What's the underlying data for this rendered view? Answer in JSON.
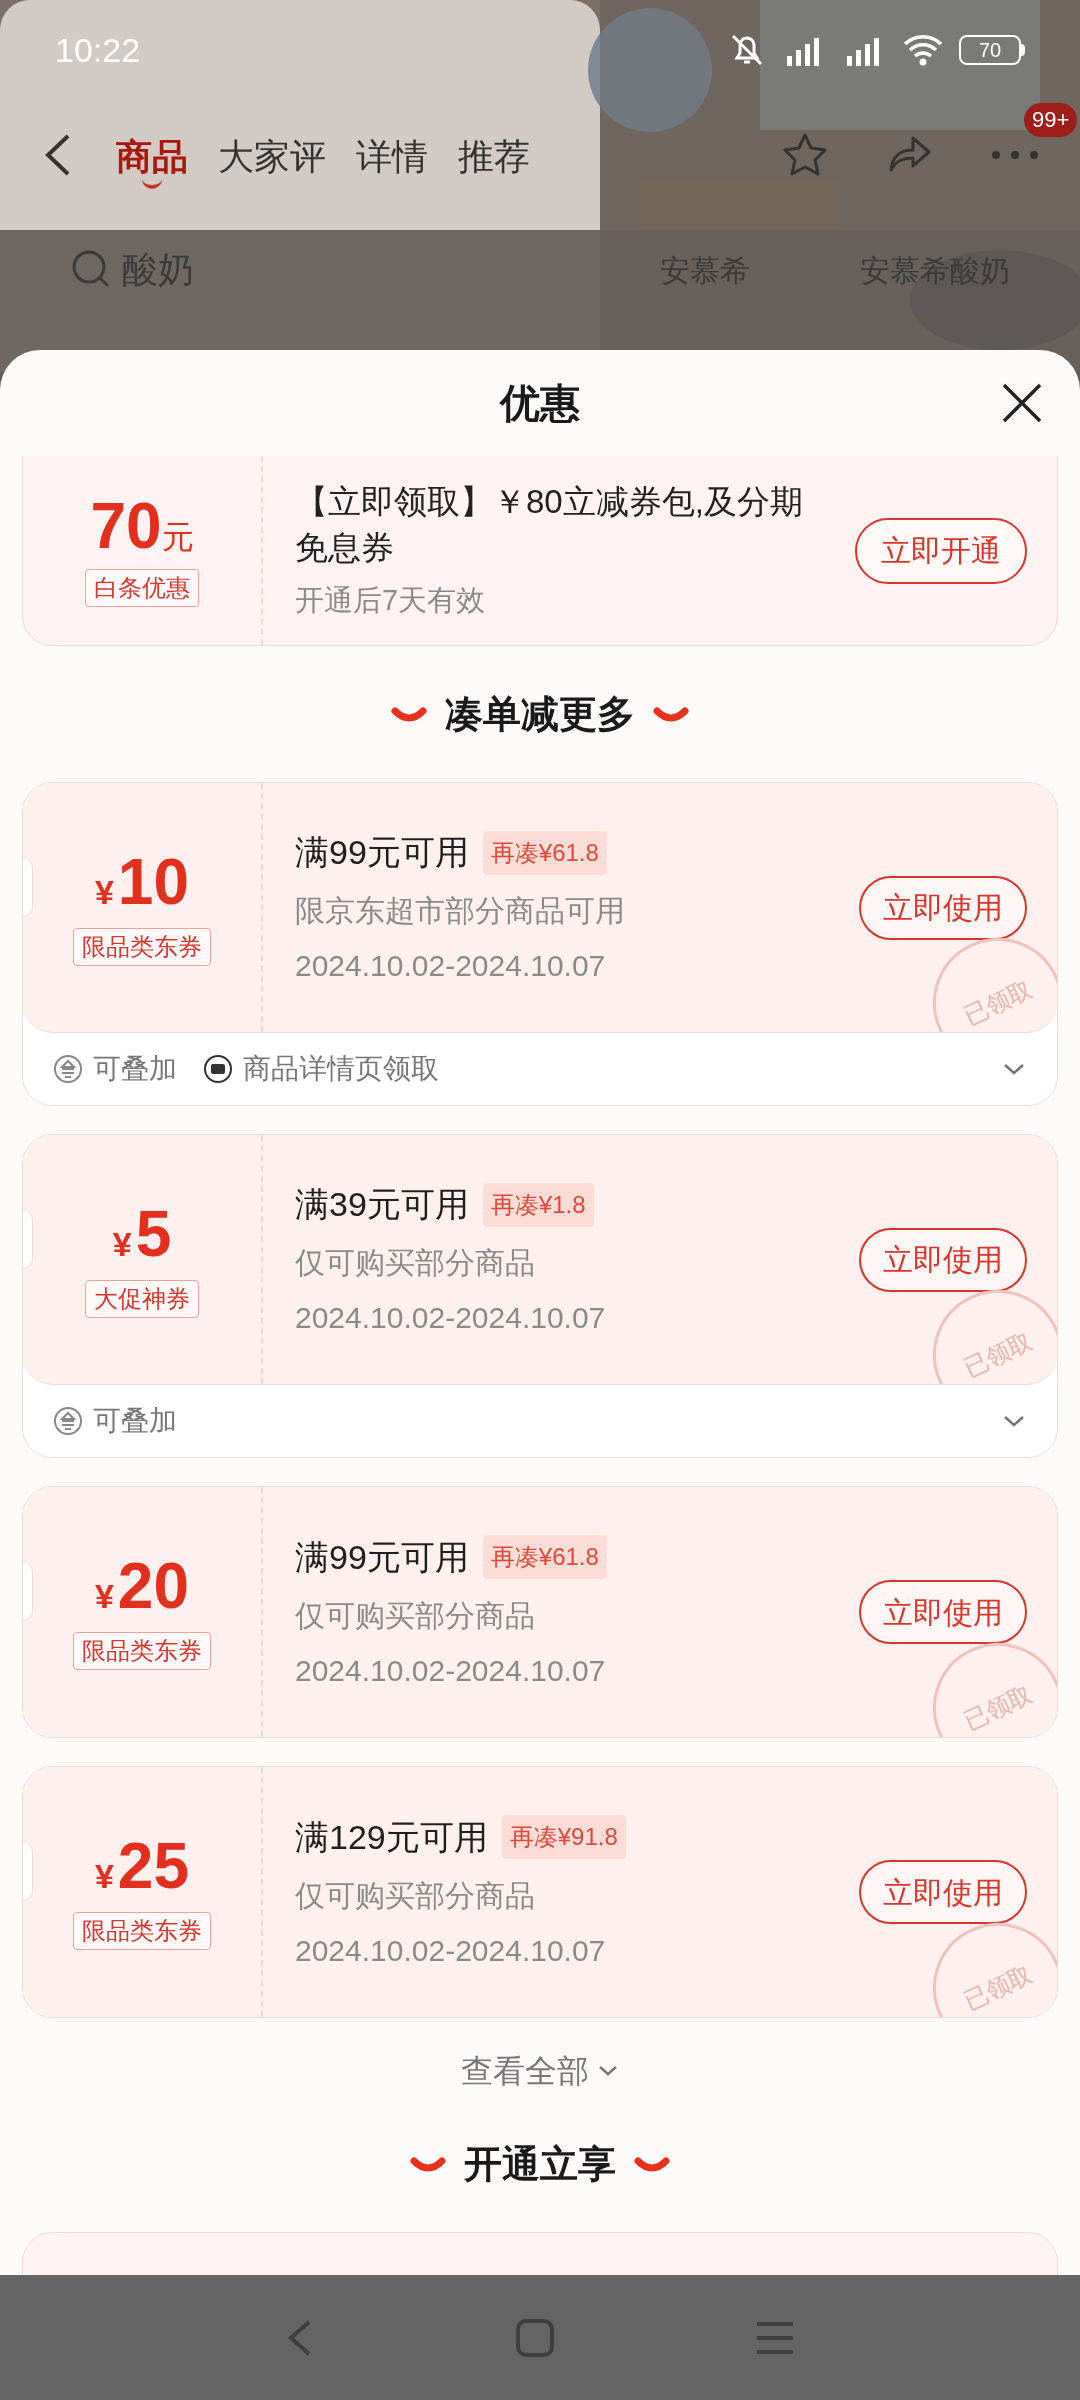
{
  "status_bar": {
    "time": "10:22",
    "battery": "70"
  },
  "nav": {
    "tabs": [
      {
        "label": "商品",
        "selected": true
      },
      {
        "label": "大家评",
        "selected": false
      },
      {
        "label": "详情",
        "selected": false
      },
      {
        "label": "推荐",
        "selected": false
      }
    ],
    "badge": "99+"
  },
  "search": {
    "value": "酸奶",
    "suggestions": [
      "安慕希",
      "安慕希酸奶"
    ]
  },
  "sheet": {
    "title": "优惠",
    "top_card": {
      "amount": "70",
      "unit": "元",
      "tag": "白条优惠",
      "title": "【立即领取】￥80立减券包,及分期免息券",
      "note": "开通后7天有效",
      "button": "立即开通"
    },
    "sections": [
      {
        "title": "凑单减更多",
        "coupons": [
          {
            "currency": "¥",
            "amount": "10",
            "tag": "限品类东券",
            "condition": "满99元可用",
            "gap": "再凑¥61.8",
            "desc": "限京东超市部分商品可用",
            "validity": "2024.10.02-2024.10.07",
            "button": "立即使用",
            "stamp": "已领取",
            "footer": [
              {
                "kind": "stack",
                "label": "可叠加"
              },
              {
                "kind": "ticket",
                "label": "商品详情页领取"
              }
            ]
          },
          {
            "currency": "¥",
            "amount": "5",
            "tag": "大促神券",
            "condition": "满39元可用",
            "gap": "再凑¥1.8",
            "desc": "仅可购买部分商品",
            "validity": "2024.10.02-2024.10.07",
            "button": "立即使用",
            "stamp": "已领取",
            "footer": [
              {
                "kind": "stack",
                "label": "可叠加"
              }
            ]
          },
          {
            "currency": "¥",
            "amount": "20",
            "tag": "限品类东券",
            "condition": "满99元可用",
            "gap": "再凑¥61.8",
            "desc": "仅可购买部分商品",
            "validity": "2024.10.02-2024.10.07",
            "button": "立即使用",
            "stamp": "已领取"
          },
          {
            "currency": "¥",
            "amount": "25",
            "tag": "限品类东券",
            "condition": "满129元可用",
            "gap": "再凑¥91.8",
            "desc": "仅可购买部分商品",
            "validity": "2024.10.02-2024.10.07",
            "button": "立即使用",
            "stamp": "已领取"
          }
        ],
        "more": "查看全部"
      },
      {
        "title": "开通立享"
      }
    ]
  }
}
